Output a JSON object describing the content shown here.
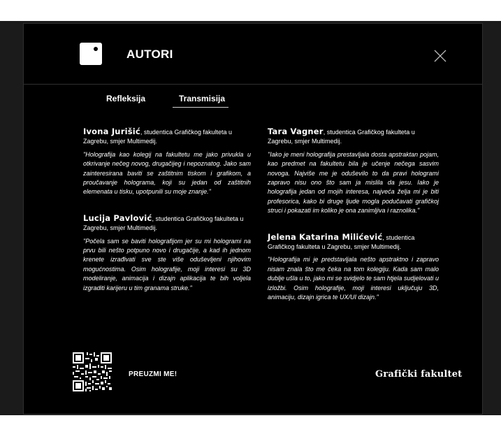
{
  "modal": {
    "title": "AUTORI",
    "tabs": [
      "Refleksija",
      "Transmisija"
    ],
    "active_tab": "Transmisija"
  },
  "authors": [
    {
      "name": "Ivona Jurišić",
      "affiliation": ", studentica Grafičkog fakulteta u Zagrebu, smjer Multimedij.",
      "quote": "\"Holografija kao kolegij na fakultetu me jako privukla u otkrivanje nečeg novog, drugačijeg i nepoznatog. Jako sam zainteresirana baviti se zaštitnim tiskom i grafikom, a proučavanje holograma, koji su jedan od zaštitnih elemenata u tisku, upotpunili su moje znanje.\""
    },
    {
      "name": "Lucija Pavlović",
      "affiliation": ", studentica Grafičkog fakulteta u Zagrebu, smjer Multimedij.",
      "quote": "\"Počela sam se baviti holografijom jer su mi hologrami na prvu bili nešto potpuno novo i drugačije, a kad ih jednom krenete izrađivati sve ste više oduševljeni njihovim mogućnostima. Osim holografije, moji interesi su 3D modeliranje, animacija i dizajn aplikacija te bih voljela izgraditi karijeru u tim granama struke.\""
    },
    {
      "name": "Tara Vagner",
      "affiliation": ", studentica Grafičkog fakulteta u Zagrebu, smjer Multimedij.",
      "quote": "\"Iako je meni holografija prestavljala dosta apstraktan pojam, kao predmet na fakultetu bila je učenje nečega sasvim novoga. Najviše me je oduševilo to da pravi hologrami zapravo nisu ono što sam ja mislila da jesu. Iako je holografija jedan od mojih interesa, najveća želja mi je biti profesorica, kako bi druge ljude mogla podučavati grafičkoj struci i pokazati im koliko je ona zanimljiva i raznolika.\""
    },
    {
      "name": "Jelena Katarina Milićević",
      "affiliation": ", studentica Grafičkog fakulteta u Zagrebu, smjer Multimedij.",
      "quote": "\"Holografija mi je predstavljala nešto apstraktno i zapravo nisam znala što me čeka na tom kolegiju. Kada sam malo dublje ušla u to, jako mi se svidjelo te sam htjela sudjelovati u izložbi. Osim holografije, moji interesi uključuju 3D, animaciju, dizajn igrica te UX/UI dizajn.\""
    }
  ],
  "footer": {
    "download_label": "PREUZMI ME!",
    "faculty_label": "Grafički fakultet"
  },
  "icons": {
    "logo": "square-logo-icon",
    "close": "close-icon",
    "qr": "qr-code-icon"
  },
  "colors": {
    "background": "#000000",
    "text": "#ffffff",
    "divider": "#303030"
  }
}
